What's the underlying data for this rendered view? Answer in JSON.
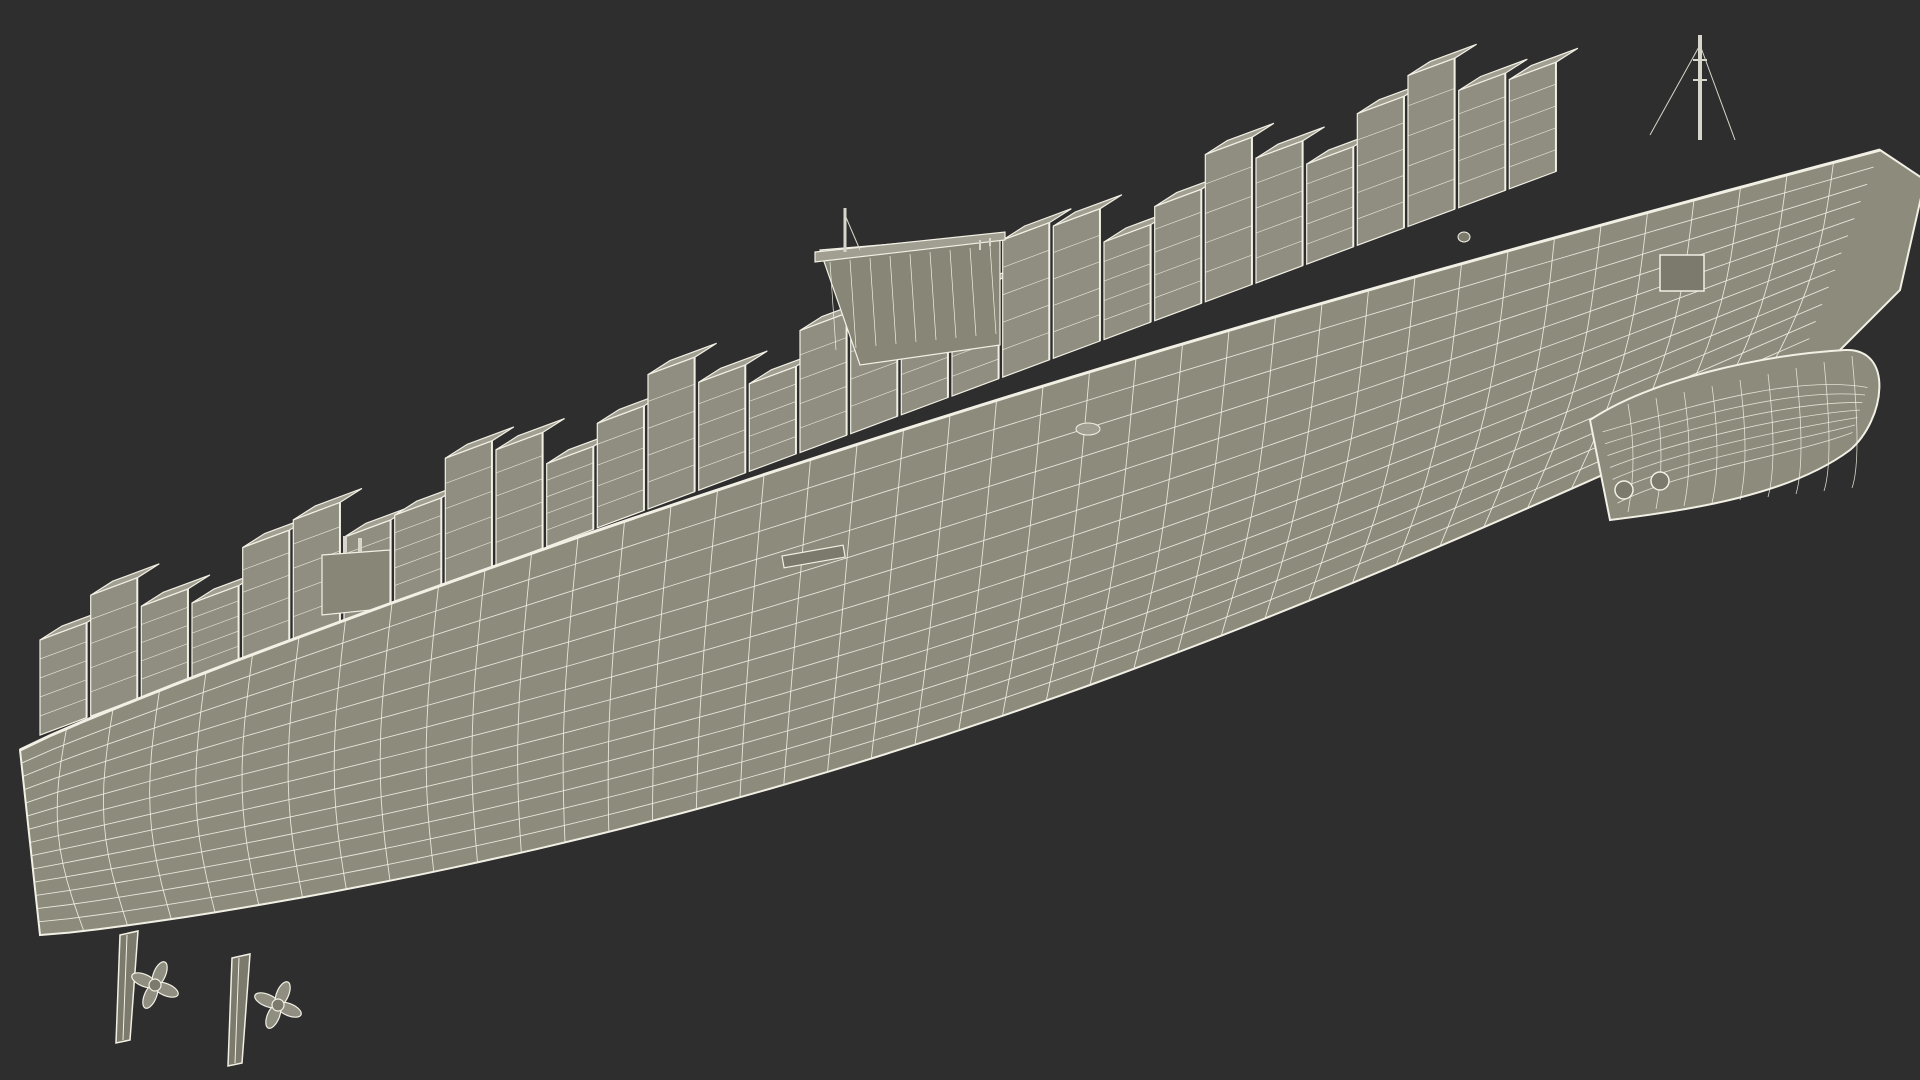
{
  "scene": {
    "subject": "container-ship-wireframe",
    "colors": {
      "background": "#2e2e2e",
      "hull_fill": "#8c8b7c",
      "hull_shade": "#7b7a6c",
      "container_fill": "#8f8e80",
      "container_top": "#a19f91",
      "wire": "#f2f0e4",
      "bridge_fill": "#878677",
      "mast": "#d8d6ca"
    },
    "container_stacks": 30,
    "hull_grid_rows": 14,
    "hull_grid_cols": 40,
    "rudders": 2,
    "propellers": 2
  }
}
